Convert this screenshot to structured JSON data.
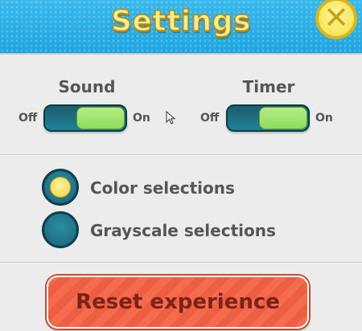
{
  "header": {
    "title": "Settings",
    "close_icon": "close-x-icon"
  },
  "sound": {
    "label": "Sound",
    "off_label": "Off",
    "on_label": "On",
    "state": "on"
  },
  "timer": {
    "label": "Timer",
    "off_label": "Off",
    "on_label": "On",
    "state": "on"
  },
  "selection_mode": {
    "options": [
      {
        "label": "Color selections",
        "selected": true
      },
      {
        "label": "Grayscale selections",
        "selected": false
      }
    ]
  },
  "reset": {
    "label": "Reset experience"
  },
  "colors": {
    "header": "#1ea4e0",
    "toggle_on": "#8fdc5c",
    "reset": "#f46b4e",
    "radio_dot": "#f3d33a"
  }
}
